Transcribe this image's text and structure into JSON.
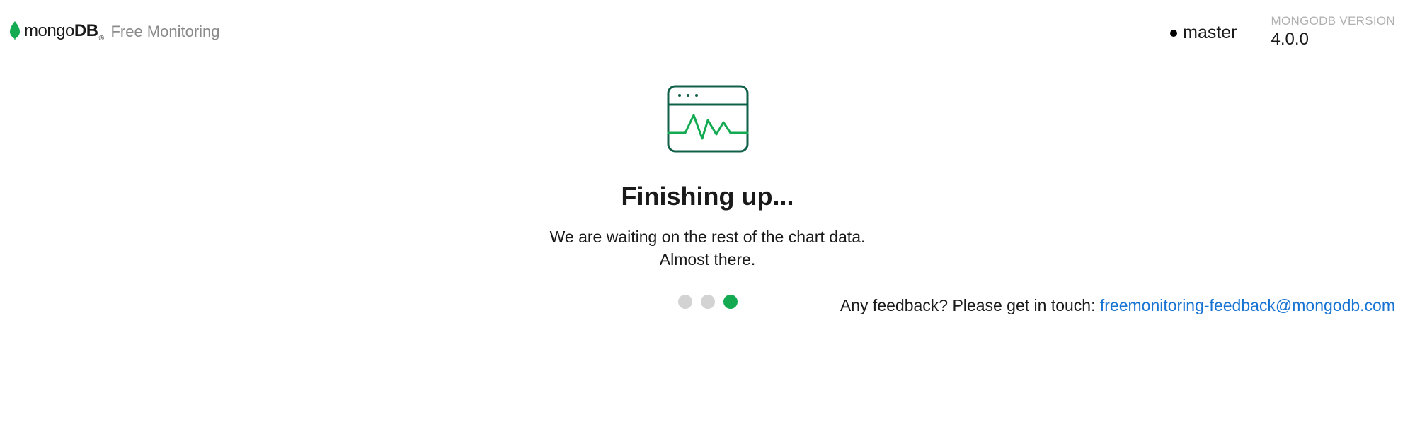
{
  "header": {
    "brand_prefix": "mongo",
    "brand_suffix": "DB",
    "product_name": "Free Monitoring",
    "status_label": "master",
    "version_label": "MONGODB VERSION",
    "version_value": "4.0.0"
  },
  "main": {
    "title": "Finishing up...",
    "subtitle_line1": "We are waiting on the rest of the chart data.",
    "subtitle_line2": "Almost there.",
    "progress_active_index": 2
  },
  "feedback": {
    "prefix": "Any feedback? Please get in touch: ",
    "email": "freemonitoring-feedback@mongodb.com"
  },
  "colors": {
    "accent": "#13aa52",
    "link": "#1874d2",
    "muted": "#b0b0b0"
  }
}
